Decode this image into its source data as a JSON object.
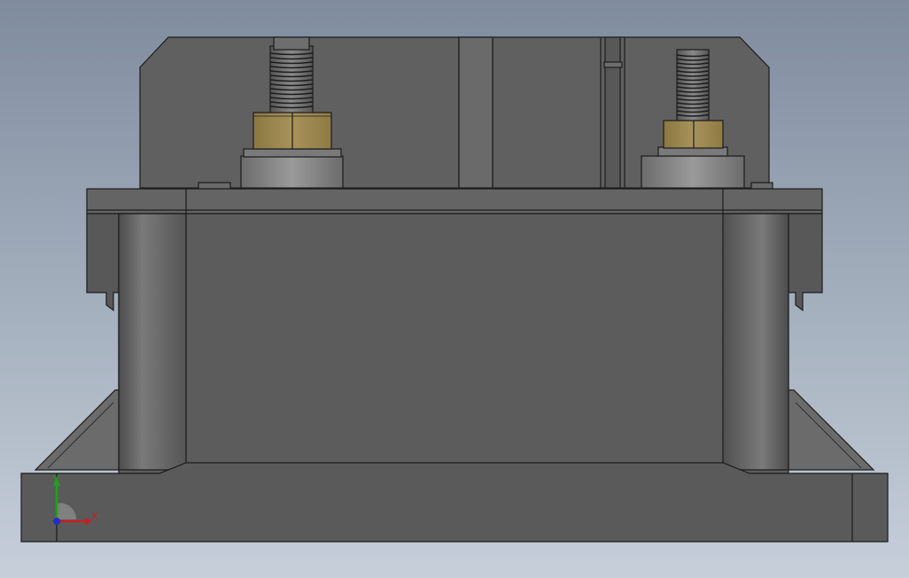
{
  "viewport": {
    "background_top": "#7f8c9e",
    "background_bottom": "#c6cfda"
  },
  "model": {
    "body_color": "#5e5e5e",
    "body_dark": "#4a4a4a",
    "edge_color": "#1c1c1c",
    "nut_color": "#a08b52",
    "nut_dark": "#7d6a36",
    "washer_color": "#8a8a8a"
  },
  "triad": {
    "x_label": "X",
    "y_label": "Y",
    "x_color": "#c81e1e",
    "y_color": "#1fa01f",
    "z_color": "#1f2fc8"
  }
}
